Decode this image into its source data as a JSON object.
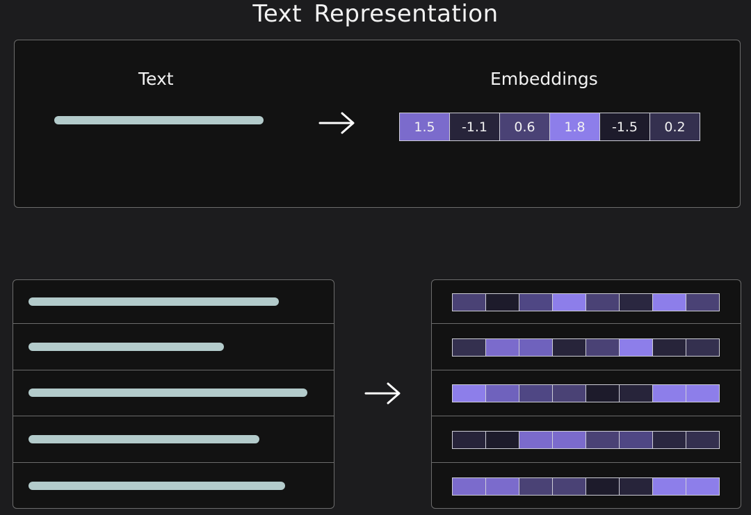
{
  "title": "Text  Representation",
  "top": {
    "text_heading": "Text",
    "embeddings_heading": "Embeddings",
    "arrow_icon": "right-arrow-icon",
    "vector": [
      {
        "value": "1.5",
        "color": "#7b6bcc"
      },
      {
        "value": "-1.1",
        "color": "#27243a"
      },
      {
        "value": "0.6",
        "color": "#4a4275"
      },
      {
        "value": "1.8",
        "color": "#8d7eea"
      },
      {
        "value": "-1.5",
        "color": "#1d1b2b"
      },
      {
        "value": "0.2",
        "color": "#34304f"
      }
    ]
  },
  "bottom": {
    "arrow_icon": "right-arrow-icon",
    "line_color": "#b3cbcb",
    "documents": [
      {
        "line_fraction": 0.78
      },
      {
        "line_fraction": 0.61
      },
      {
        "line_fraction": 0.87
      },
      {
        "line_fraction": 0.72
      },
      {
        "line_fraction": 0.8
      }
    ],
    "embedding_rows": [
      [
        "#4a4275",
        "#1d1b2b",
        "#4f4784",
        "#8d7eea",
        "#4a4275",
        "#2a2740",
        "#8d7eea",
        "#4a4275"
      ],
      [
        "#34304f",
        "#7b6bcc",
        "#6f62bd",
        "#27243a",
        "#4a4275",
        "#8d7eea",
        "#27243a",
        "#34304f"
      ],
      [
        "#8d7eea",
        "#6f62bd",
        "#4f4784",
        "#4a4275",
        "#1d1b2b",
        "#27243a",
        "#8d7eea",
        "#8d7eea"
      ],
      [
        "#27243a",
        "#1d1b2b",
        "#7b6bcc",
        "#7b6bcc",
        "#4a4275",
        "#4f4784",
        "#2a2740",
        "#34304f"
      ],
      [
        "#7b6bcc",
        "#7b6bcc",
        "#4a4275",
        "#4a4275",
        "#1d1b2b",
        "#27243a",
        "#8d7eea",
        "#8d7eea"
      ]
    ]
  }
}
